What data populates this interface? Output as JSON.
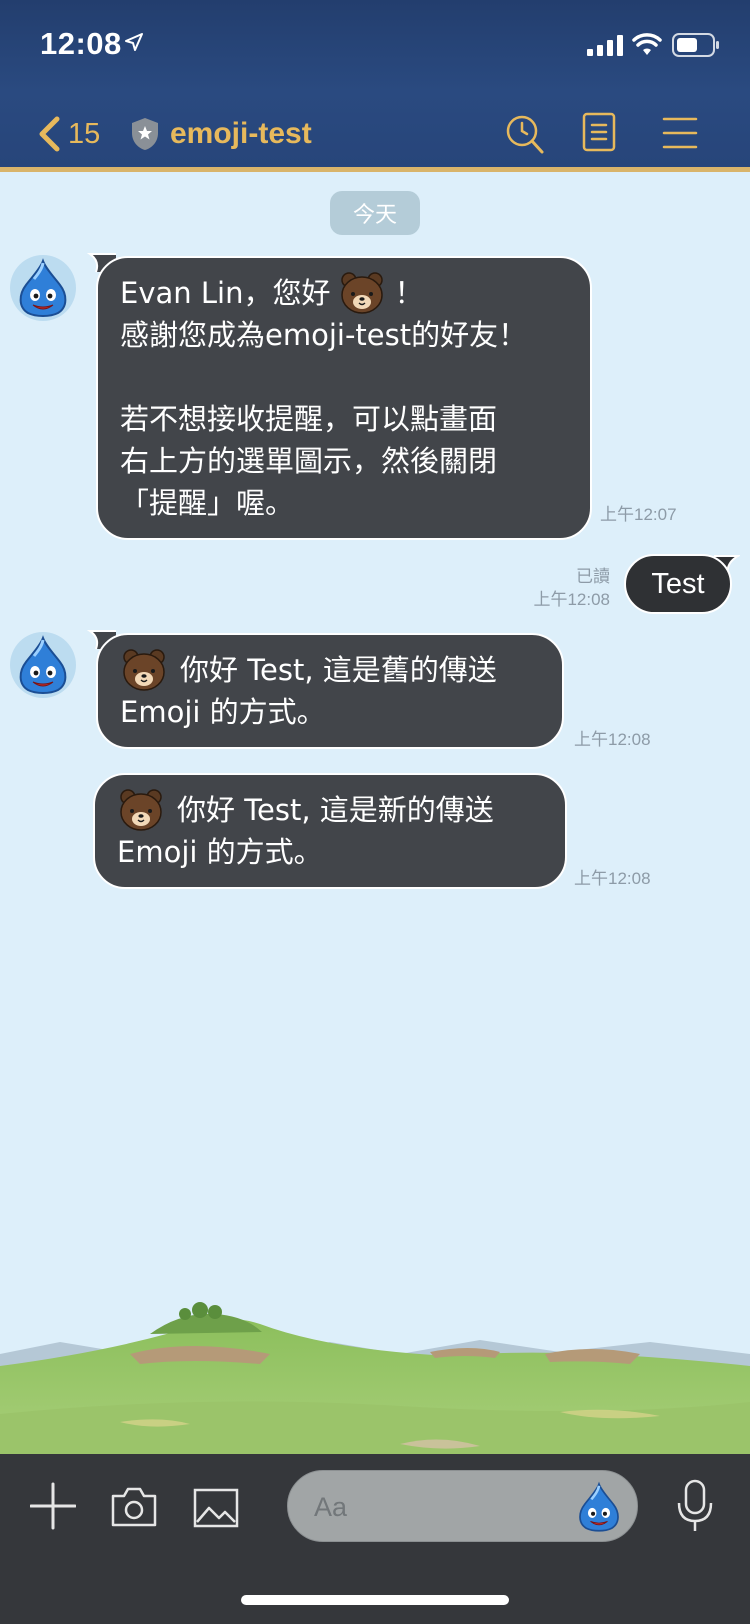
{
  "status_bar": {
    "time": "12:08"
  },
  "nav": {
    "back_count": "15",
    "title": "emoji-test"
  },
  "chat": {
    "date_label": "今天",
    "msg1": {
      "lines": [
        "Evan Lin，您好",
        "！",
        "感謝您成為emoji-test的好友！",
        "若不想接收提醒，可以點畫面",
        "右上方的選單圖示，然後關閉",
        "「提醒」喔。"
      ],
      "time": "上午12:07"
    },
    "out_msg": {
      "text": "Test",
      "read": "已讀",
      "time": "上午12:08"
    },
    "msg2": {
      "line1": "你好 Test, 這是舊的傳送",
      "line2": "Emoji 的方式。",
      "time": "上午12:08"
    },
    "msg3": {
      "line1": "你好 Test, 這是新的傳送",
      "line2": "Emoji 的方式。",
      "time": "上午12:08"
    }
  },
  "input": {
    "placeholder": "Aa"
  },
  "colors": {
    "accent": "#e7b95c",
    "header_bg": "#27457a",
    "bubble_bg": "#42454a",
    "chat_bg": "#ddeffa"
  }
}
